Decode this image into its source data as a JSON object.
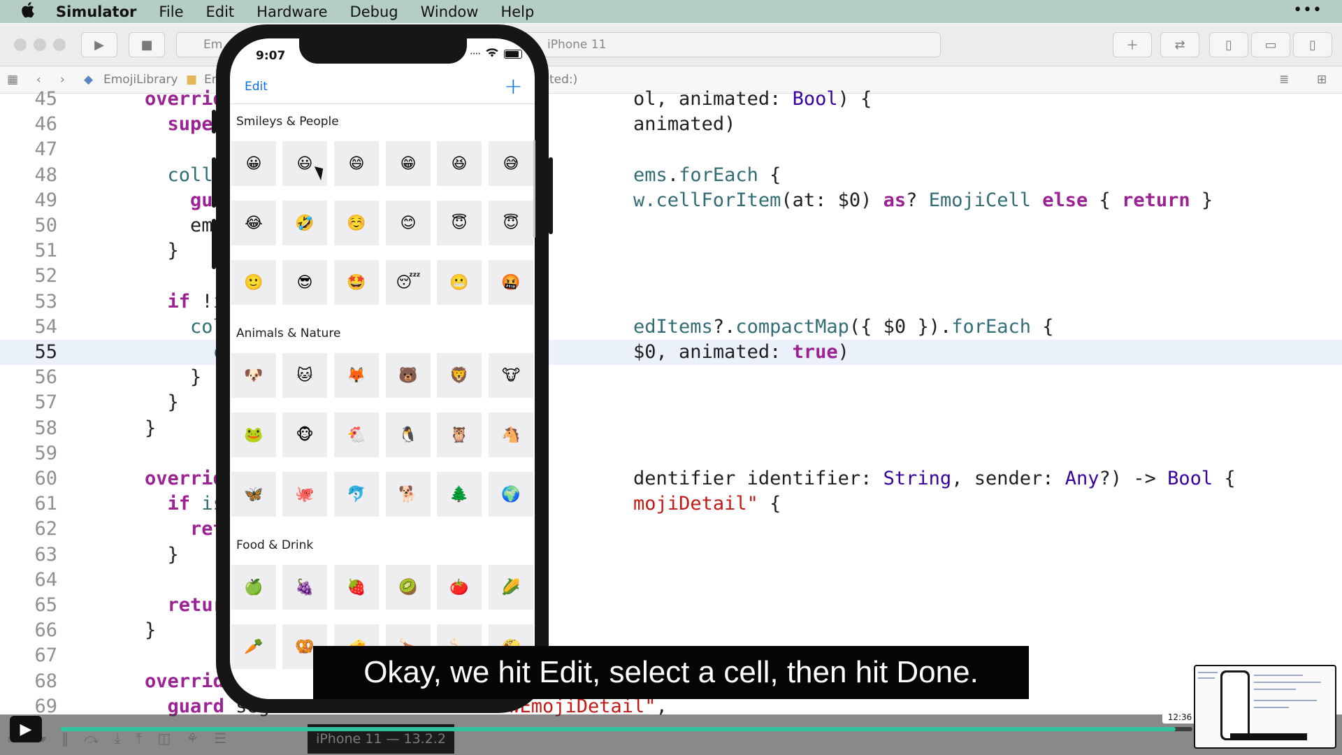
{
  "menu_bar": {
    "apple": "",
    "app_name": "Simulator",
    "items": [
      "File",
      "Edit",
      "Hardware",
      "Debug",
      "Window",
      "Help"
    ],
    "more": "•••"
  },
  "toolbar": {
    "scheme_left": "Em",
    "device": "iPhone 11"
  },
  "jump_bar": {
    "project": "EmojiLibrary",
    "folder": "Em",
    "crumb_tail": "ted:)"
  },
  "editor": {
    "current_line": 55,
    "lines": [
      {
        "n": "45",
        "parts": [
          [
            "    ",
            ""
          ],
          [
            "override",
            "kw"
          ],
          [
            " f",
            ""
          ],
          [
            "                                 ",
            ""
          ],
          [
            "ol, animated: ",
            ""
          ],
          [
            "Bool",
            "ty"
          ],
          [
            ") {",
            ""
          ]
        ]
      },
      {
        "n": "46",
        "parts": [
          [
            "      ",
            ""
          ],
          [
            "super",
            "kw"
          ],
          [
            ".se",
            ""
          ],
          [
            "                                 ",
            ""
          ],
          [
            "animated)",
            ""
          ]
        ]
      },
      {
        "n": "47",
        "parts": [
          [
            "",
            ""
          ]
        ]
      },
      {
        "n": "48",
        "parts": [
          [
            "      ",
            ""
          ],
          [
            "collecti",
            "fn"
          ],
          [
            "                                 ",
            ""
          ],
          [
            "ems",
            "fn"
          ],
          [
            ".",
            ""
          ],
          [
            "forEach",
            "fn"
          ],
          [
            " {",
            ""
          ]
        ]
      },
      {
        "n": "49",
        "parts": [
          [
            "        ",
            ""
          ],
          [
            "guard",
            "kw"
          ],
          [
            "                                  ",
            ""
          ],
          [
            "w.",
            "fn"
          ],
          [
            "cellForItem",
            "fn"
          ],
          [
            "(at: $0) ",
            ""
          ],
          [
            "as",
            "kw"
          ],
          [
            "? ",
            ""
          ],
          [
            "EmojiCell",
            "fn"
          ],
          [
            " ",
            ""
          ],
          [
            "else",
            "kw"
          ],
          [
            " { ",
            ""
          ],
          [
            "return",
            "kw"
          ],
          [
            " }",
            ""
          ]
        ]
      },
      {
        "n": "50",
        "parts": [
          [
            "        emojiC",
            ""
          ]
        ]
      },
      {
        "n": "51",
        "parts": [
          [
            "      }",
            ""
          ]
        ]
      },
      {
        "n": "52",
        "parts": [
          [
            "",
            ""
          ]
        ]
      },
      {
        "n": "53",
        "parts": [
          [
            "      ",
            ""
          ],
          [
            "if",
            "kw"
          ],
          [
            " !",
            ""
          ],
          [
            "isEd",
            "fn"
          ]
        ]
      },
      {
        "n": "54",
        "parts": [
          [
            "        ",
            ""
          ],
          [
            "collec",
            "fn"
          ],
          [
            "                                 ",
            ""
          ],
          [
            "edItems",
            "fn"
          ],
          [
            "?.",
            ""
          ],
          [
            "compactMap",
            "fn"
          ],
          [
            "({ $0 }).",
            ""
          ],
          [
            "forEach",
            "fn"
          ],
          [
            " {",
            ""
          ]
        ]
      },
      {
        "n": "55",
        "parts": [
          [
            "          ",
            ""
          ],
          [
            "coll",
            "fn"
          ],
          [
            "                                 ",
            ""
          ],
          [
            "$0, animated: ",
            ""
          ],
          [
            "true",
            "kw"
          ],
          [
            ")",
            ""
          ]
        ]
      },
      {
        "n": "56",
        "parts": [
          [
            "        }",
            ""
          ]
        ]
      },
      {
        "n": "57",
        "parts": [
          [
            "      }",
            ""
          ]
        ]
      },
      {
        "n": "58",
        "parts": [
          [
            "    }",
            ""
          ]
        ]
      },
      {
        "n": "59",
        "parts": [
          [
            "",
            ""
          ]
        ]
      },
      {
        "n": "60",
        "parts": [
          [
            "    ",
            ""
          ],
          [
            "override",
            "kw"
          ],
          [
            " f",
            ""
          ],
          [
            "                                 ",
            ""
          ],
          [
            "dentifier identifier: ",
            ""
          ],
          [
            "String",
            "ty"
          ],
          [
            ", sender: ",
            ""
          ],
          [
            "Any",
            "ty"
          ],
          [
            "?) -> ",
            ""
          ],
          [
            "Bool",
            "ty"
          ],
          [
            " {",
            ""
          ]
        ]
      },
      {
        "n": "61",
        "parts": [
          [
            "      ",
            ""
          ],
          [
            "if",
            "kw"
          ],
          [
            " ",
            ""
          ],
          [
            "isEdi",
            "fn"
          ],
          [
            "                                 ",
            ""
          ],
          [
            "mojiDetail\"",
            "str"
          ],
          [
            " {",
            ""
          ]
        ]
      },
      {
        "n": "62",
        "parts": [
          [
            "        ",
            ""
          ],
          [
            "return",
            "kw"
          ]
        ]
      },
      {
        "n": "63",
        "parts": [
          [
            "      }",
            ""
          ]
        ]
      },
      {
        "n": "64",
        "parts": [
          [
            "",
            ""
          ]
        ]
      },
      {
        "n": "65",
        "parts": [
          [
            "      ",
            ""
          ],
          [
            "return",
            "kw"
          ],
          [
            " t",
            ""
          ]
        ]
      },
      {
        "n": "66",
        "parts": [
          [
            "    }",
            ""
          ]
        ]
      },
      {
        "n": "67",
        "parts": [
          [
            "",
            ""
          ]
        ]
      },
      {
        "n": "68",
        "parts": [
          [
            "    ",
            ""
          ],
          [
            "override",
            "kw"
          ],
          [
            " f",
            ""
          ]
        ]
      },
      {
        "n": "69",
        "parts": [
          [
            "      ",
            ""
          ],
          [
            "guard",
            "kw"
          ],
          [
            " segue.",
            ""
          ],
          [
            "identifier",
            "fn"
          ],
          [
            " == ",
            ""
          ],
          [
            "\"ShowEmojiDetail\"",
            "str"
          ],
          [
            ",",
            ""
          ]
        ]
      }
    ]
  },
  "simulator": {
    "status_time": "9:07",
    "status_icons": "....  ᯤ",
    "nav_edit": "Edit",
    "nav_add": "+",
    "sections": [
      {
        "title": "Smileys & People",
        "rows": [
          [
            "😀",
            "😃",
            "😄",
            "😁",
            "😆",
            "😅"
          ],
          [
            "😂",
            "🤣",
            "☺️",
            "😊",
            "😇",
            "😇"
          ],
          [
            "🙂",
            "😎",
            "🤩",
            "😴",
            "😬",
            "🤬"
          ]
        ]
      },
      {
        "title": "Animals & Nature",
        "rows": [
          [
            "🐶",
            "🐱",
            "🦊",
            "🐻",
            "🦁",
            "🐮"
          ],
          [
            "🐸",
            "🐵",
            "🐔",
            "🐧",
            "🦉",
            "🐴"
          ],
          [
            "🦋",
            "🐙",
            "🐬",
            "🐕",
            "🌲",
            "🌍"
          ]
        ]
      },
      {
        "title": "Food & Drink",
        "rows": [
          [
            "🍏",
            "🍇",
            "🍓",
            "🥝",
            "🍅",
            "🌽"
          ],
          [
            "🥕",
            "🥨",
            "🧀",
            "🍗",
            "🦴",
            "🌮"
          ]
        ]
      }
    ]
  },
  "video": {
    "caption": "Okay, we hit Edit, select a cell, then hit Done.",
    "timestamp": "12:36",
    "progress_fraction": 0.985,
    "play_icon": "▶",
    "tray_label": "iPhone 11 — 13.2.2",
    "accent_color": "#32c2a0"
  }
}
